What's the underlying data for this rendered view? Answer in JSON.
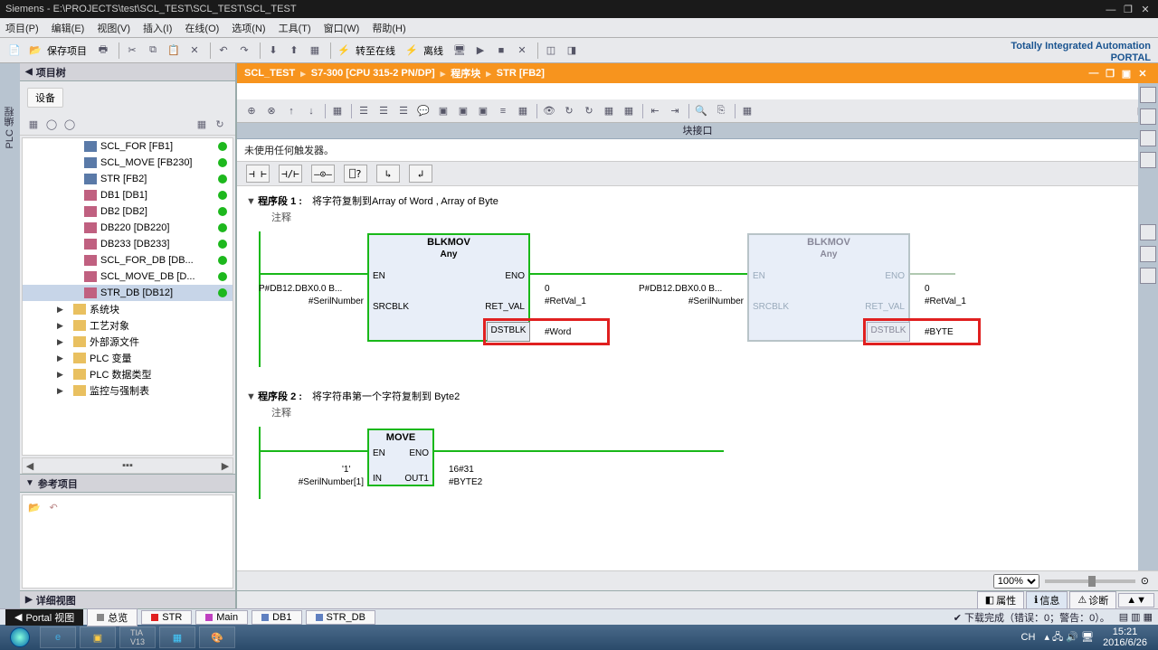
{
  "window": {
    "title": "Siemens  -  E:\\PROJECTS\\test\\SCL_TEST\\SCL_TEST\\SCL_TEST"
  },
  "menu": [
    "项目(P)",
    "编辑(E)",
    "视图(V)",
    "插入(I)",
    "在线(O)",
    "选项(N)",
    "工具(T)",
    "窗口(W)",
    "帮助(H)"
  ],
  "main_actions": {
    "save": "保存项目",
    "online": "转至在线",
    "offline": "离线"
  },
  "brand": {
    "line1": "Totally Integrated Automation",
    "line2": "PORTAL"
  },
  "left_strip": "PLC 编程",
  "project_tree": {
    "title": "项目树",
    "device_tab": "设备",
    "items": [
      {
        "label": "SCL_FOR [FB1]",
        "type": "block",
        "dot": true
      },
      {
        "label": "SCL_MOVE [FB230]",
        "type": "block",
        "dot": true
      },
      {
        "label": "STR [FB2]",
        "type": "block",
        "dot": true
      },
      {
        "label": "DB1 [DB1]",
        "type": "db",
        "dot": true
      },
      {
        "label": "DB2 [DB2]",
        "type": "db",
        "dot": true
      },
      {
        "label": "DB220 [DB220]",
        "type": "db",
        "dot": true
      },
      {
        "label": "DB233 [DB233]",
        "type": "db",
        "dot": true
      },
      {
        "label": "SCL_FOR_DB [DB...",
        "type": "db",
        "dot": true
      },
      {
        "label": "SCL_MOVE_DB [D...",
        "type": "db",
        "dot": true
      },
      {
        "label": "STR_DB [DB12]",
        "type": "db",
        "dot": true,
        "sel": true
      }
    ],
    "parents": [
      {
        "label": "系统块",
        "type": "folder"
      },
      {
        "label": "工艺对象",
        "type": "folder"
      },
      {
        "label": "外部源文件",
        "type": "folder"
      },
      {
        "label": "PLC 变量",
        "type": "folder"
      },
      {
        "label": "PLC 数据类型",
        "type": "folder"
      },
      {
        "label": "监控与强制表",
        "type": "folder"
      }
    ],
    "ref_title": "参考项目",
    "detail_title": "详细视图"
  },
  "editor": {
    "crumbs": [
      "SCL_TEST",
      "S7-300 [CPU 315-2 PN/DP]",
      "程序块",
      "STR [FB2]"
    ],
    "iface": "块接口",
    "trigger": "未使用任何触发器。",
    "net1": {
      "title": "程序段 1 :",
      "desc": "将字符复制到Array of Word , Array of Byte",
      "comment": "注释"
    },
    "net2": {
      "title": "程序段 2 :",
      "desc": "将字符串第一个字符复制到 Byte2",
      "comment": "注释"
    },
    "blk1": {
      "name": "BLKMOV",
      "sub": "Any",
      "en": "EN",
      "eno": "ENO",
      "srcblk": "SRCBLK",
      "retval": "RET_VAL",
      "dstblk": "DSTBLK",
      "src_in": "P#DB12.DBX0.0 B...",
      "src_var": "#SerilNumber",
      "ret_zero": "0",
      "ret_var": "#RetVal_1",
      "dst_var": "#Word"
    },
    "blk2": {
      "name": "BLKMOV",
      "sub": "Any",
      "en": "EN",
      "eno": "ENO",
      "srcblk": "SRCBLK",
      "retval": "RET_VAL",
      "dstblk": "DSTBLK",
      "src_in": "P#DB12.DBX0.0 B...",
      "src_var": "#SerilNumber",
      "ret_zero": "0",
      "ret_var": "#RetVal_1",
      "dst_var": "#BYTE"
    },
    "move": {
      "name": "MOVE",
      "en": "EN",
      "eno": "ENO",
      "in": "IN",
      "out1": "OUT1",
      "in_top": "'1'",
      "in_var": "#SerilNumber[1]",
      "out_top": "16#31",
      "out_var": "#BYTE2"
    },
    "zoom": "100%"
  },
  "props_tabs": {
    "props": "属性",
    "info": "信息",
    "diag": "诊断"
  },
  "status": {
    "portal": "Portal 视图",
    "tabs": [
      {
        "label": "总览",
        "color": "#888"
      },
      {
        "label": "STR",
        "color": "#e02020"
      },
      {
        "label": "Main",
        "color": "#c040c0"
      },
      {
        "label": "DB1",
        "color": "#6080c0"
      },
      {
        "label": "STR_DB",
        "color": "#6080c0"
      }
    ],
    "download": "下载完成（错误：0；警告：0）。"
  },
  "taskbar": {
    "tray": {
      "ime": "CH",
      "time": "15:21",
      "date": "2016/6/26"
    }
  }
}
